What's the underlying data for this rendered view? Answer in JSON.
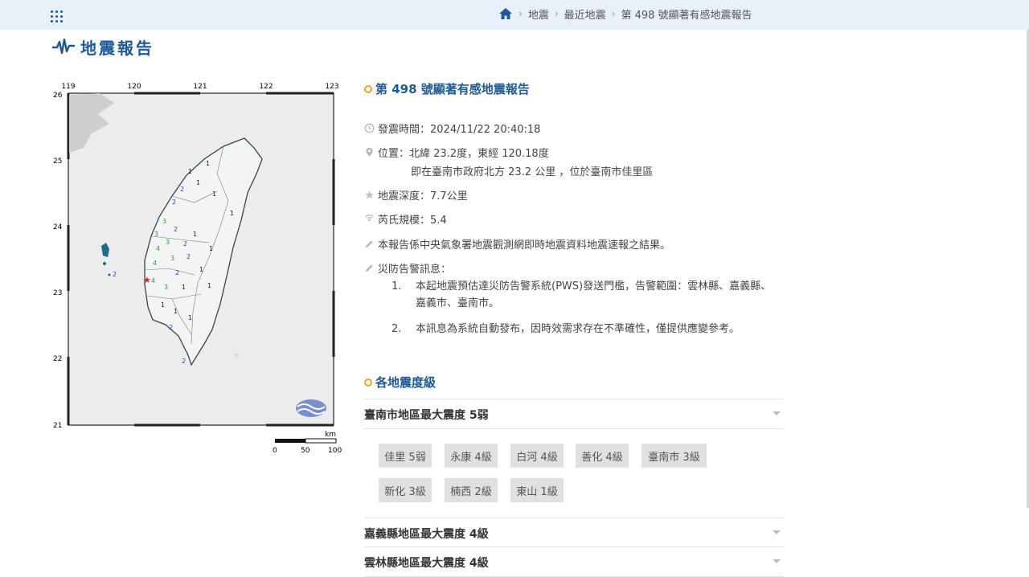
{
  "breadcrumb": {
    "items": [
      "地震",
      "最近地震",
      "第 498 號顯著有感地震報告"
    ]
  },
  "page_title": "地震報告",
  "map": {
    "lon_ticks": [
      "119",
      "120",
      "121",
      "122",
      "123"
    ],
    "lat_ticks": [
      "26",
      "25",
      "24",
      "23",
      "22",
      "21"
    ],
    "scale_unit": "km",
    "scale_labels": [
      "0",
      "50",
      "100"
    ],
    "epicenter_marker": "★",
    "intensity_digits": [
      "1",
      "2",
      "3",
      "4"
    ],
    "colors": {
      "level1": "#222222",
      "level2": "#2f3fb5",
      "level3": "#2a9d2a",
      "level4": "#2a9d2a",
      "epicenter": "#e02020"
    }
  },
  "report": {
    "title": "第 498 號顯著有感地震報告",
    "time": "發震時間：2024/11/22 20:40:18",
    "location_line1": "位置：北緯 23.2度，東經 120.18度",
    "location_line2": "即在臺南市政府北方 23.2 公里 ，位於臺南市佳里區",
    "depth": "地震深度：7.7公里",
    "magnitude": "芮氏規模：5.4",
    "source_note": "本報告係中央氣象署地震觀測網即時地震資料地震速報之結果。",
    "warning_title": "災防告警訊息：",
    "warnings": [
      {
        "num": "1.",
        "text": "本起地震預估達災防告警系統(PWS)發送門檻，告警範圍：雲林縣、嘉義縣、嘉義市、臺南市。"
      },
      {
        "num": "2.",
        "text": "本訊息為系統自動發布，因時效需求存在不準確性，僅提供應變參考。"
      }
    ]
  },
  "intensity_section": {
    "title": "各地震度級",
    "regions": [
      {
        "label": "臺南市地區最大震度 5弱",
        "chips": [
          "佳里 5弱",
          "永康 4級",
          "白河 4級",
          "善化 4級",
          "臺南市 3級",
          "新化 3級",
          "楠西 2級",
          "東山 1級"
        ]
      },
      {
        "label": "嘉義縣地區最大震度 4級"
      },
      {
        "label": "雲林縣地區最大震度 4級"
      }
    ]
  }
}
